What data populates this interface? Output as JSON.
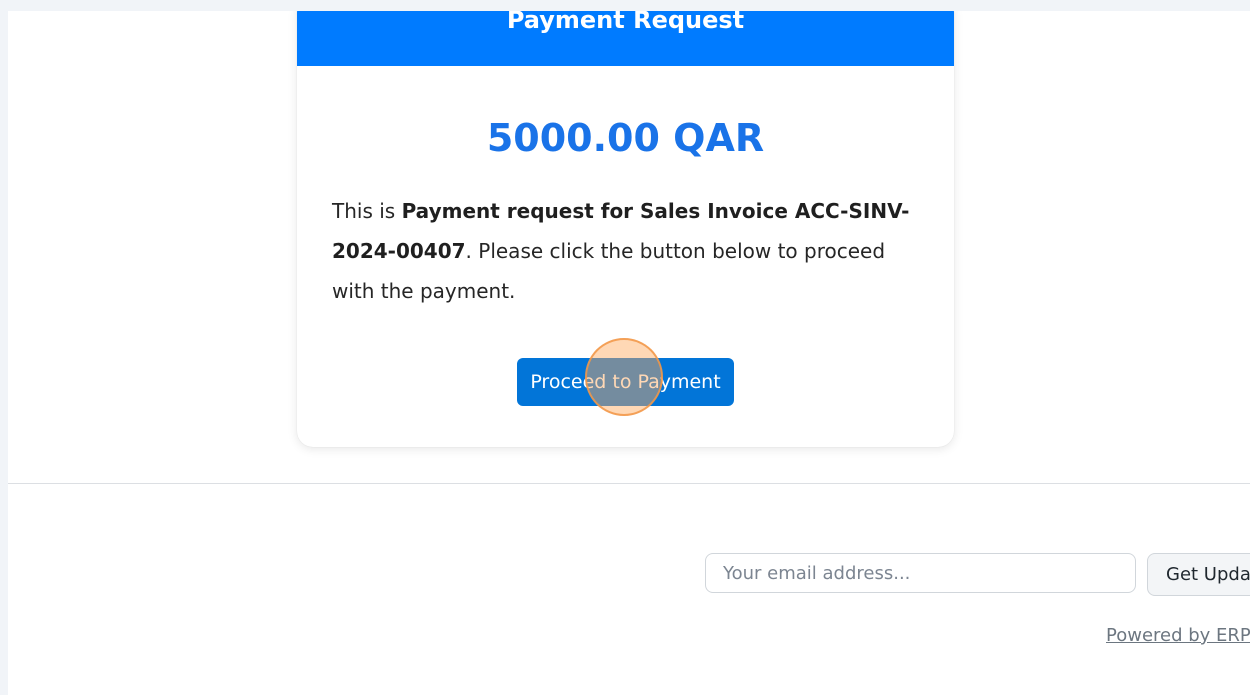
{
  "card": {
    "title": "Payment Request",
    "amount": "5000.00 QAR",
    "message_prefix": "This is ",
    "message_bold": "Payment request for Sales Invoice ACC-SINV-2024-00407",
    "message_suffix": ". Please click the button below to proceed with the payment.",
    "proceed_label": "Proceed to Payment"
  },
  "footer": {
    "email_placeholder": "Your email address...",
    "updates_label": "Get Updates",
    "powered_by": "Powered by ERPNext"
  },
  "colors": {
    "header_bg": "#007bff",
    "amount_text": "#1a73e8",
    "button_bg": "#0275d8",
    "click_indicator": "#f29646"
  }
}
